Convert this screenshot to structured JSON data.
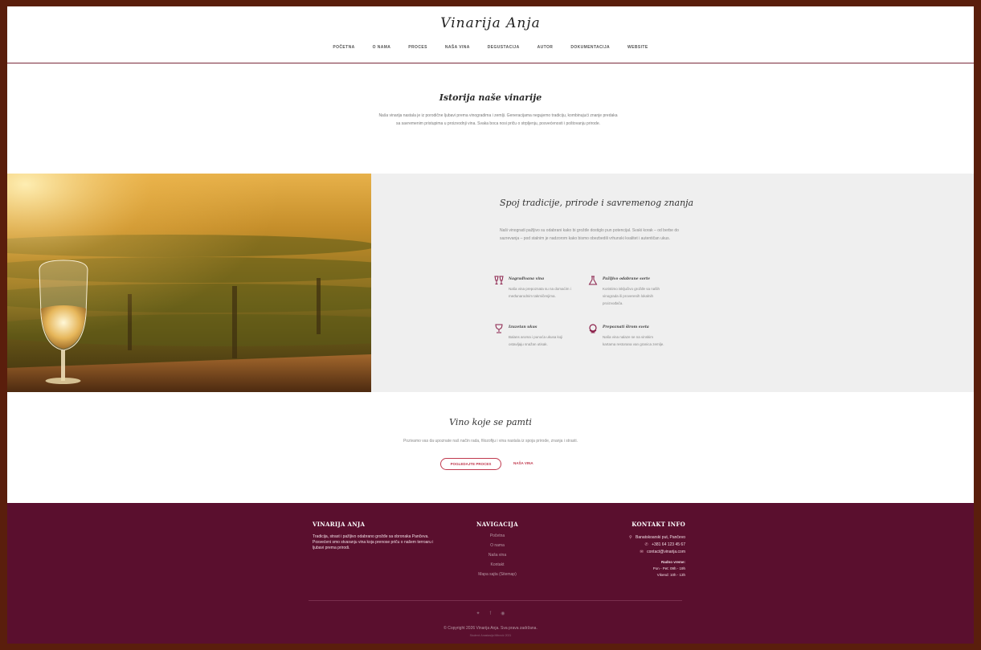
{
  "header": {
    "logo": "Vinarija Anja",
    "nav": [
      "POČETNA",
      "O NAMA",
      "PROCES",
      "NAŠA VINA",
      "DEGUSTACIJA",
      "AUTOR",
      "DOKUMENTACIJA",
      "WEBSITE"
    ]
  },
  "history": {
    "title": "Istorija naše vinarije",
    "text": "Naša vinarija nastala je iz porodične ljubavi prema vinogradima i zemlji. Generacijama negujemo tradiciju, kombinujući znanje predaka sa savremenim pristupima u proizvodnji vina. Svaka boca nosi priču o strpljenju, posvećenosti i poštovanju prirode."
  },
  "feature": {
    "title": "Spoj tradicije, prirode i savremenog znanja",
    "text": "Naši vinogradi pažljivo su odabrani kako bi grožđe dostiglo pun potencijal. Svaki korak – od berbe do sazrevanja – pod stalnim je nadzorom kako bismo obezbedili vrhunski kvalitet i autentičan ukus.",
    "items": [
      {
        "icon": "glasses-icon",
        "title": "Nagrađivana vina",
        "text": "Naša vina prepoznata su na domaćim i međunarodnim takmičenjima."
      },
      {
        "icon": "flask-icon",
        "title": "Pažljivo odabrane sorte",
        "text": "Koristimo isključivo grožđe sa naših vinograda ili proverenih lokalnih proizvođača."
      },
      {
        "icon": "wine-glass-icon",
        "title": "Izuzetan ukus",
        "text": "Balans aroma i punoća ukusa koji ostavljaju snažan utisak."
      },
      {
        "icon": "globe-icon",
        "title": "Prepoznati širom sveta",
        "text": "Naša vina nalaze se na vinskim kartama restorana van granica zemlje."
      }
    ]
  },
  "wine": {
    "title": "Vino koje se pamti",
    "text": "Pozivamo vas da upoznate naš način rada, filozofiju i vina nastala iz spoja prirode, znanja i strasti.",
    "button_primary": "POGLEDAJTE PROCES",
    "button_secondary": "NAŠA VINA"
  },
  "footer": {
    "about_title": "VINARIJA ANJA",
    "about_text": "Tradicija, strast i pažljivo odabrano grožđe sa obronaka Pančeva. Posvećeni smo stvaranju vina koja prenose priču o našem terroaru i ljubavi prema prirodi.",
    "nav_title": "NAVIGACIJA",
    "nav_links": [
      "Početna",
      "O nama",
      "Naša vina",
      "Kontakt",
      "Mapa sajta (Sitemap)"
    ],
    "contact_title": "KONTAKT INFO",
    "address": "Banatskoarski put, Pančevo",
    "phone": "+381 64 123 45 67",
    "email": "contact@vinarija.com",
    "hours_title": "Radno vreme:",
    "hours_weekday": "Pon - Pet: 09h - 19h",
    "hours_weekend": "Vikend: 10h - 13h",
    "social": [
      "twitter-icon",
      "facebook-icon",
      "instagram-icon"
    ],
    "copyright": "© Copyright 2026 Vinarija Anja. Sva prava zadržana.",
    "credit": "Student: Anastasija Mitrović 2021"
  }
}
